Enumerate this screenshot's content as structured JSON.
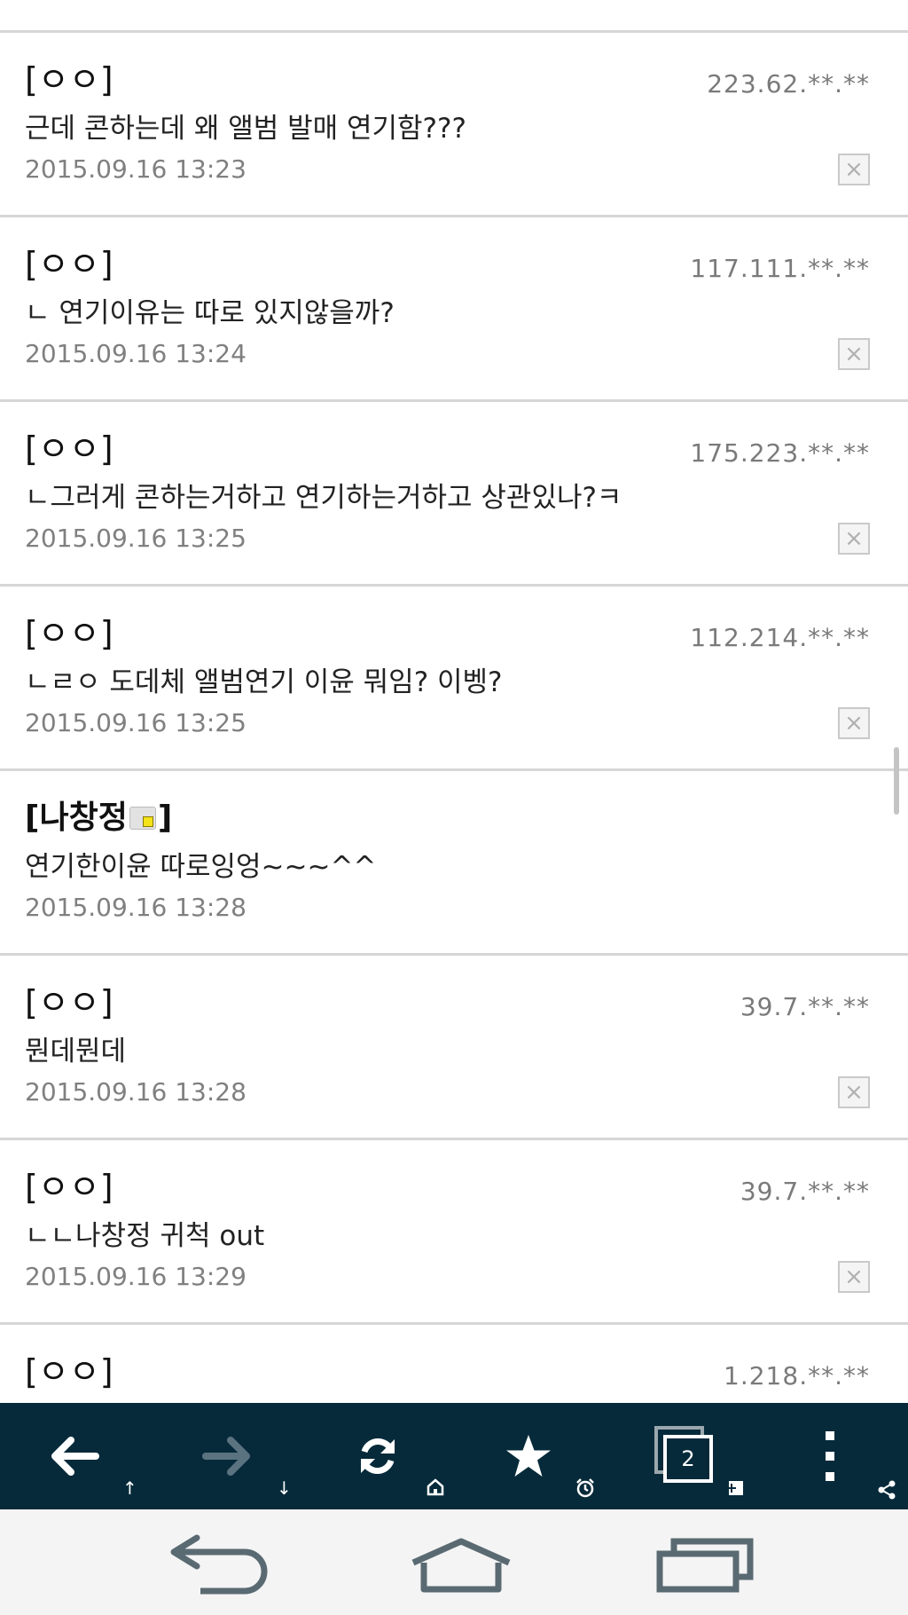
{
  "comments": [
    {
      "nick": "[ㅇㅇ]",
      "ip": "223.62.**.**",
      "text": "근데 콘하는데 왜 앨범 발매 연기함???",
      "date": "2015.09.16 13:23"
    },
    {
      "nick": "[ㅇㅇ]",
      "ip": "117.111.**.**",
      "text": "ㄴ 연기이유는 따로 있지않을까?",
      "date": "2015.09.16 13:24"
    },
    {
      "nick": "[ㅇㅇ]",
      "ip": "175.223.**.**",
      "text": "ㄴ그러게 콘하는거하고 연기하는거하고 상관있나?ㅋ",
      "date": "2015.09.16 13:25"
    },
    {
      "nick": "[ㅇㅇ]",
      "ip": "112.214.**.**",
      "text": "ㄴㄹㅇ 도데체 앨범연기 이윤 뭐임? 이벵?",
      "date": "2015.09.16 13:25"
    },
    {
      "nick_open": "[",
      "nick_name": "나창정",
      "nick_close": "]",
      "text": "연기한이윤 따로잉엉~~~^^",
      "date": "2015.09.16 13:28"
    },
    {
      "nick": "[ㅇㅇ]",
      "ip": "39.7.**.**",
      "text": "뭔데뭔데",
      "date": "2015.09.16 13:28"
    },
    {
      "nick": "[ㅇㅇ]",
      "ip": "39.7.**.**",
      "text": "ㄴㄴ나창정 귀척 out",
      "date": "2015.09.16 13:29"
    },
    {
      "nick": "[ㅇㅇ]",
      "ip": "1.218.**.**"
    }
  ],
  "delete_symbol": "×",
  "toolbar": {
    "tab_count": "2",
    "back_sub": "↑",
    "forward_sub": "↓",
    "colors": {
      "background": "#062a3a",
      "icon": "#ffffff",
      "disabled": "#5b7380"
    }
  }
}
